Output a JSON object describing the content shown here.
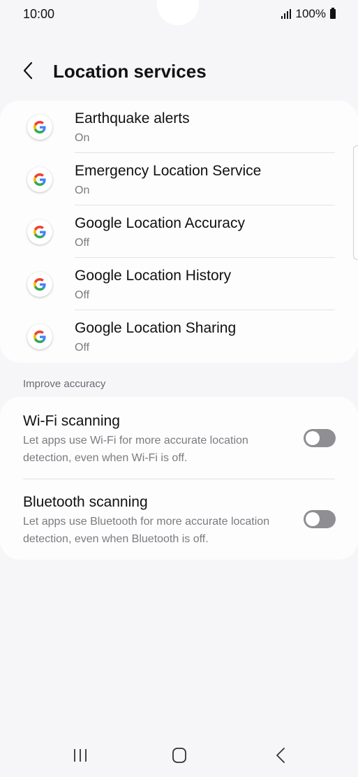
{
  "status_bar": {
    "time": "10:00",
    "battery": "100%"
  },
  "header": {
    "title": "Location services",
    "back_icon": "chevron-left-icon"
  },
  "apps": [
    {
      "title": "Earthquake alerts",
      "status": "On",
      "icon": "google-g-icon"
    },
    {
      "title": "Emergency Location Service",
      "status": "On",
      "icon": "google-g-icon"
    },
    {
      "title": "Google Location Accuracy",
      "status": "Off",
      "icon": "google-g-icon"
    },
    {
      "title": "Google Location History",
      "status": "Off",
      "icon": "google-g-icon"
    },
    {
      "title": "Google Location Sharing",
      "status": "Off",
      "icon": "google-g-icon"
    }
  ],
  "improve_accuracy": {
    "section_label": "Improve accuracy",
    "items": [
      {
        "title": "Wi-Fi scanning",
        "description": "Let apps use Wi-Fi for more accurate location detection, even when Wi-Fi is off.",
        "enabled": false
      },
      {
        "title": "Bluetooth scanning",
        "description": "Let apps use Bluetooth for more accurate location detection, even when Bluetooth is off.",
        "enabled": false
      }
    ]
  },
  "nav": {
    "recents_icon": "recents-icon",
    "home_icon": "home-icon",
    "back_icon": "back-icon"
  },
  "colors": {
    "background": "#f6f6f8",
    "card": "#fdfdfe",
    "toggle_off": "#8e8e93",
    "secondary_text": "#7b7b80"
  }
}
